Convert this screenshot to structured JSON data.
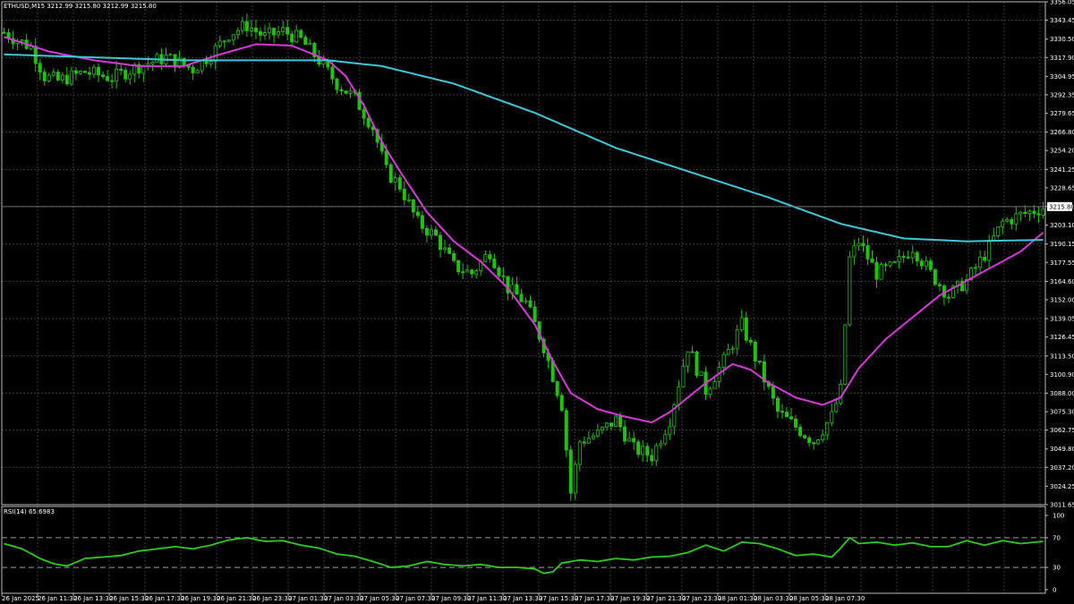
{
  "header": {
    "symbol_info": "ETHUSD,M15  3212.99 3215.80 3212.99 3215.80",
    "rsi_info": "RSI(14) 65.6983"
  },
  "colors": {
    "background": "#000000",
    "grid": "#3a3a3a",
    "candle": "#22c10f",
    "ma_fast": "#d838d8",
    "ma_slow": "#3cc8d8",
    "rsi_line": "#2ccc1c",
    "price_label_bg": "#ffffff"
  },
  "chart_data": [
    {
      "type": "candlestick",
      "symbol": "ETHUSD",
      "timeframe": "M15",
      "current_price": 3215.8,
      "current_price_label": "3215.80",
      "y_ticks": [
        "3356.05",
        "3343.45",
        "3330.50",
        "3317.90",
        "3304.95",
        "3292.35",
        "3279.65",
        "3266.80",
        "3254.20",
        "3241.25",
        "3228.65",
        "3215.80",
        "3203.10",
        "3190.15",
        "3177.55",
        "3164.60",
        "3152.00",
        "3139.05",
        "3126.45",
        "3113.50",
        "3100.90",
        "3088.00",
        "3075.30",
        "3062.75",
        "3049.80",
        "3037.20",
        "3024.25",
        "3011.65"
      ],
      "ylim": [
        3011.65,
        3356.05
      ],
      "x_ticks": [
        "26 Jan 2025",
        "26 Jan 11:30",
        "26 Jan 13:30",
        "26 Jan 15:30",
        "26 Jan 17:30",
        "26 Jan 19:30",
        "26 Jan 21:30",
        "26 Jan 23:30",
        "27 Jan 01:30",
        "27 Jan 03:30",
        "27 Jan 05:30",
        "27 Jan 07:30",
        "27 Jan 09:30",
        "27 Jan 11:30",
        "27 Jan 13:30",
        "27 Jan 15:30",
        "27 Jan 17:30",
        "27 Jan 19:30",
        "27 Jan 21:30",
        "27 Jan 23:30",
        "28 Jan 01:30",
        "28 Jan 03:30",
        "28 Jan 05:30",
        "28 Jan 07:30"
      ],
      "grid": true,
      "close_path": [
        [
          0,
          3335
        ],
        [
          6,
          3325
        ],
        [
          9,
          3305
        ],
        [
          12,
          3302
        ],
        [
          18,
          3308
        ],
        [
          24,
          3304
        ],
        [
          30,
          3312
        ],
        [
          36,
          3318
        ],
        [
          42,
          3310
        ],
        [
          46,
          3320
        ],
        [
          50,
          3334
        ],
        [
          54,
          3340
        ],
        [
          58,
          3332
        ],
        [
          62,
          3336
        ],
        [
          66,
          3330
        ],
        [
          70,
          3316
        ],
        [
          74,
          3300
        ],
        [
          78,
          3290
        ],
        [
          82,
          3270
        ],
        [
          85,
          3240
        ],
        [
          88,
          3230
        ],
        [
          92,
          3205
        ],
        [
          96,
          3195
        ],
        [
          100,
          3175
        ],
        [
          104,
          3170
        ],
        [
          108,
          3185
        ],
        [
          112,
          3160
        ],
        [
          116,
          3150
        ],
        [
          120,
          3120
        ],
        [
          124,
          3080
        ],
        [
          126,
          3020
        ],
        [
          128,
          3055
        ],
        [
          132,
          3060
        ],
        [
          136,
          3070
        ],
        [
          140,
          3050
        ],
        [
          144,
          3045
        ],
        [
          148,
          3070
        ],
        [
          152,
          3120
        ],
        [
          156,
          3090
        ],
        [
          160,
          3110
        ],
        [
          164,
          3135
        ],
        [
          168,
          3105
        ],
        [
          172,
          3075
        ],
        [
          176,
          3065
        ],
        [
          180,
          3055
        ],
        [
          184,
          3072
        ],
        [
          186,
          3090
        ],
        [
          188,
          3180
        ],
        [
          190,
          3192
        ],
        [
          194,
          3170
        ],
        [
          198,
          3175
        ],
        [
          202,
          3188
        ],
        [
          206,
          3170
        ],
        [
          210,
          3155
        ],
        [
          214,
          3165
        ],
        [
          218,
          3183
        ],
        [
          222,
          3205
        ],
        [
          226,
          3210
        ],
        [
          231,
          3215
        ]
      ],
      "series": [
        {
          "name": "",
          "role": "fast",
          "values": [
            [
              0,
              3332
            ],
            [
              10,
              3322
            ],
            [
              20,
              3316
            ],
            [
              30,
              3312
            ],
            [
              40,
              3312
            ],
            [
              48,
              3320
            ],
            [
              56,
              3327
            ],
            [
              64,
              3326
            ],
            [
              72,
              3316
            ],
            [
              76,
              3305
            ],
            [
              80,
              3285
            ],
            [
              84,
              3260
            ],
            [
              88,
              3240
            ],
            [
              94,
              3212
            ],
            [
              100,
              3192
            ],
            [
              106,
              3178
            ],
            [
              112,
              3160
            ],
            [
              118,
              3135
            ],
            [
              122,
              3110
            ],
            [
              126,
              3088
            ],
            [
              132,
              3077
            ],
            [
              138,
              3072
            ],
            [
              144,
              3068
            ],
            [
              148,
              3075
            ],
            [
              152,
              3085
            ],
            [
              156,
              3095
            ],
            [
              162,
              3108
            ],
            [
              166,
              3104
            ],
            [
              170,
              3095
            ],
            [
              176,
              3085
            ],
            [
              182,
              3080
            ],
            [
              186,
              3085
            ],
            [
              190,
              3105
            ],
            [
              196,
              3125
            ],
            [
              202,
              3140
            ],
            [
              208,
              3155
            ],
            [
              214,
              3165
            ],
            [
              220,
              3175
            ],
            [
              226,
              3185
            ],
            [
              231,
              3198
            ]
          ]
        },
        {
          "name": "",
          "role": "slow",
          "values": [
            [
              0,
              3320
            ],
            [
              20,
              3318
            ],
            [
              40,
              3316
            ],
            [
              60,
              3316
            ],
            [
              72,
              3316
            ],
            [
              84,
              3312
            ],
            [
              100,
              3300
            ],
            [
              118,
              3280
            ],
            [
              136,
              3256
            ],
            [
              154,
              3238
            ],
            [
              170,
              3222
            ],
            [
              186,
              3204
            ],
            [
              200,
              3194
            ],
            [
              214,
              3192
            ],
            [
              231,
              3193
            ]
          ]
        }
      ]
    },
    {
      "type": "line",
      "label": "RSI(14)",
      "value": 65.6983,
      "ylim": [
        0,
        100
      ],
      "y_ticks": [
        100,
        70,
        30,
        0
      ],
      "levels": [
        70,
        30
      ],
      "x": [
        0,
        4,
        8,
        11,
        14,
        18,
        22,
        26,
        30,
        34,
        38,
        42,
        46,
        50,
        54,
        58,
        62,
        66,
        70,
        74,
        78,
        82,
        86,
        90,
        94,
        98,
        102,
        106,
        110,
        114,
        118,
        120,
        122,
        124,
        128,
        132,
        136,
        140,
        144,
        148,
        152,
        156,
        160,
        164,
        168,
        172,
        176,
        180,
        184,
        186,
        188,
        190,
        194,
        198,
        202,
        206,
        210,
        214,
        218,
        222,
        226,
        231
      ],
      "values": [
        62,
        55,
        42,
        35,
        32,
        42,
        44,
        46,
        52,
        55,
        58,
        55,
        60,
        67,
        70,
        65,
        66,
        60,
        56,
        48,
        45,
        38,
        30,
        32,
        38,
        34,
        32,
        34,
        30,
        30,
        28,
        22,
        24,
        36,
        40,
        38,
        42,
        40,
        44,
        45,
        50,
        60,
        52,
        64,
        62,
        55,
        46,
        48,
        44,
        56,
        70,
        62,
        64,
        60,
        63,
        58,
        58,
        66,
        60,
        66,
        62,
        65
      ]
    }
  ]
}
